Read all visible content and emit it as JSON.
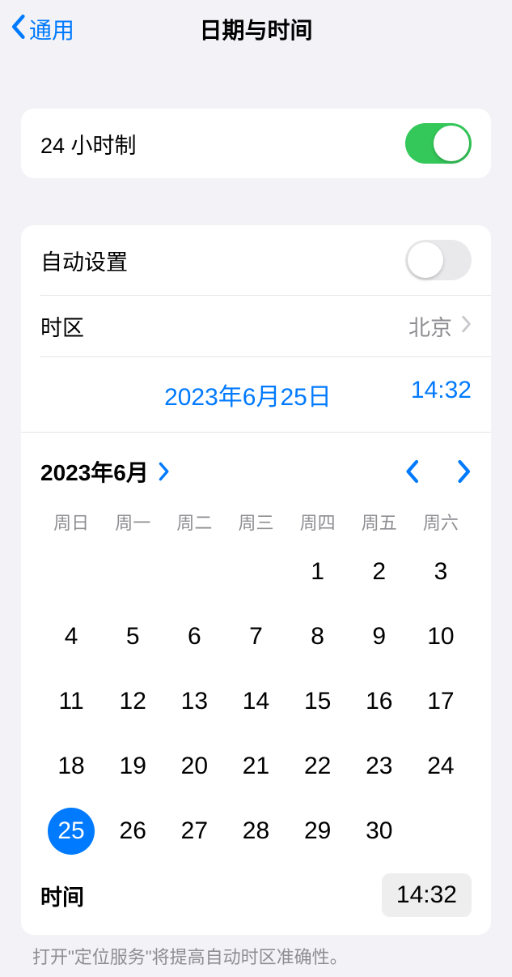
{
  "header": {
    "back_label": "通用",
    "title": "日期与时间"
  },
  "section1": {
    "twenty_four_hour_label": "24 小时制",
    "twenty_four_hour_on": true
  },
  "section2": {
    "auto_set_label": "自动设置",
    "auto_set_on": false,
    "timezone_label": "时区",
    "timezone_value": "北京",
    "date_display": "2023年6月25日",
    "time_display": "14:32"
  },
  "calendar": {
    "month_label": "2023年6月",
    "weekdays": [
      "周日",
      "周一",
      "周二",
      "周三",
      "周四",
      "周五",
      "周六"
    ],
    "weeks": [
      [
        "",
        "",
        "",
        "",
        "1",
        "2",
        "3"
      ],
      [
        "4",
        "5",
        "6",
        "7",
        "8",
        "9",
        "10"
      ],
      [
        "11",
        "12",
        "13",
        "14",
        "15",
        "16",
        "17"
      ],
      [
        "18",
        "19",
        "20",
        "21",
        "22",
        "23",
        "24"
      ],
      [
        "25",
        "26",
        "27",
        "28",
        "29",
        "30",
        ""
      ]
    ],
    "selected_day": "25",
    "time_label": "时间",
    "time_value": "14:32"
  },
  "footer_note": "打开\"定位服务\"将提高自动时区准确性。"
}
